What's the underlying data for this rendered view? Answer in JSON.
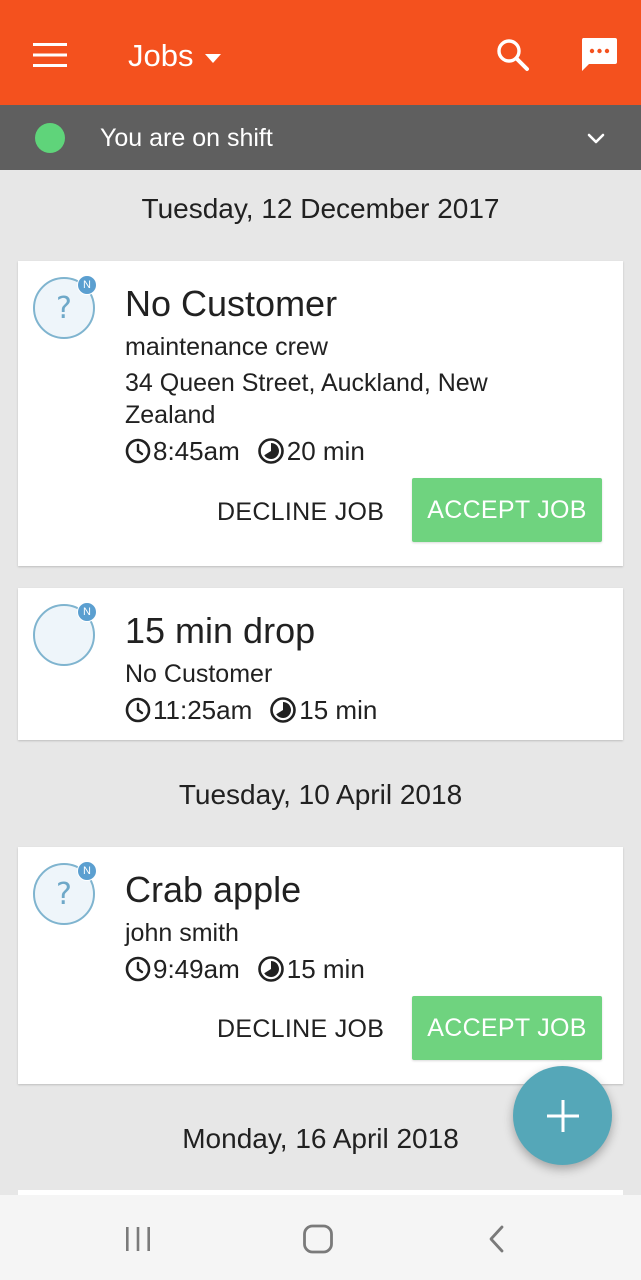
{
  "appbar": {
    "title": "Jobs",
    "bg_color": "#f4511e",
    "icons": {
      "menu": "hamburger-menu-icon",
      "dropdown": "caret-down-icon",
      "search": "search-icon",
      "chat": "chat-bubble-icon"
    }
  },
  "shift": {
    "status_text": "You are on shift",
    "status_color": "#5fd47a",
    "bar_color": "#5f5f5f"
  },
  "groups": [
    {
      "date": "Tuesday, 12 December 2017"
    },
    {
      "date": "Tuesday, 10 April 2018"
    },
    {
      "date": "Monday, 16 April 2018"
    }
  ],
  "jobs": [
    {
      "title": "No Customer",
      "subtitle": "maintenance crew",
      "address": "34 Queen Street, Auckland, New Zealand",
      "time": "8:45am",
      "duration": "20 min",
      "avatar_glyph": "?",
      "badge": "N",
      "decline_label": "DECLINE JOB",
      "accept_label": "ACCEPT JOB"
    },
    {
      "title": "15 min drop",
      "subtitle": "No Customer",
      "time": "11:25am",
      "duration": "15 min",
      "badge": "N"
    },
    {
      "title": "Crab apple",
      "subtitle": "john smith",
      "time": "9:49am",
      "duration": "15 min",
      "avatar_glyph": "?",
      "badge": "N",
      "decline_label": "DECLINE JOB",
      "accept_label": "ACCEPT JOB"
    }
  ],
  "colors": {
    "accept": "#6fd37f",
    "fab": "#55a7b8",
    "avatar_border": "#7fb4cf",
    "badge": "#5b9fd0"
  },
  "fab": {
    "icon": "plus-icon"
  },
  "system_nav": {
    "recents": "recents-icon",
    "home": "home-icon",
    "back": "back-icon"
  }
}
